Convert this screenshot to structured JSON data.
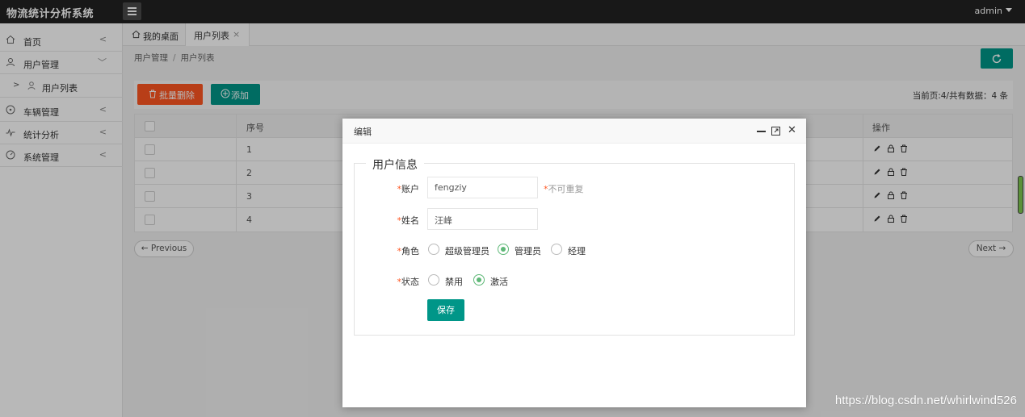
{
  "app": {
    "title": "物流统计分析系统",
    "user": "admin"
  },
  "sidebar": {
    "items": [
      {
        "label": "首页",
        "icon": "home-icon"
      },
      {
        "label": "用户管理",
        "icon": "user-icon"
      },
      {
        "label": "用户列表",
        "icon": "user-small-icon"
      },
      {
        "label": "车辆管理",
        "icon": "vehicle-icon"
      },
      {
        "label": "统计分析",
        "icon": "pulse-icon"
      },
      {
        "label": "系统管理",
        "icon": "gauge-icon"
      }
    ]
  },
  "tabs": [
    {
      "label": "我的桌面"
    },
    {
      "label": "用户列表",
      "close": "×"
    }
  ],
  "breadcrumb": {
    "root": "用户管理",
    "sep": "/",
    "current": "用户列表"
  },
  "toolbar": {
    "batch_delete": "批量删除",
    "add": "添加",
    "page_info": "当前页:4/共有数据：4 条"
  },
  "table": {
    "headers": {
      "seq": "序号",
      "ops": "操作"
    },
    "rows": [
      "1",
      "2",
      "3",
      "4"
    ]
  },
  "pager": {
    "prev": "← Previous",
    "next": "Next →"
  },
  "modal": {
    "title": "编辑",
    "legend": "用户信息",
    "required_mark": "*",
    "account": {
      "label": "账户",
      "value": "fengziy",
      "hint": "不可重复"
    },
    "name": {
      "label": "姓名",
      "value": "汪峰"
    },
    "role": {
      "label": "角色",
      "options": [
        "超级管理员",
        "管理员",
        "经理"
      ],
      "selected": "管理员"
    },
    "status": {
      "label": "状态",
      "options": [
        "禁用",
        "激活"
      ],
      "selected": "激活"
    },
    "save": "保存"
  },
  "watermark": "https://blog.csdn.net/whirlwind526",
  "colors": {
    "primary": "#009688",
    "danger": "#ff5722",
    "topbar": "#222222",
    "radio_on": "#5fb878"
  }
}
